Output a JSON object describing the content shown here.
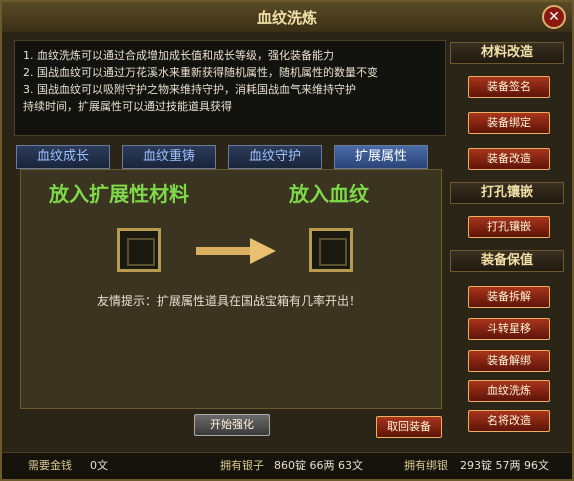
{
  "window": {
    "title": "血纹洗炼",
    "close_label": "✕"
  },
  "description": {
    "lines": [
      "1. 血纹洗炼可以通过合成增加成长值和成长等级，强化装备能力",
      "2. 国战血纹可以通过万花溪水来重新获得随机属性，随机属性的数量不变",
      "3. 国战血纹可以吸附守护之物来维持守护，消耗国战血气来维持守护",
      "持续时间，扩展属性可以通过技能道具获得"
    ]
  },
  "tabs": [
    {
      "label": "血纹成长"
    },
    {
      "label": "血纹重铸"
    },
    {
      "label": "血纹守护"
    },
    {
      "label": "扩展属性"
    }
  ],
  "panel": {
    "left_header": "放入扩展性材料",
    "right_header": "放入血纹",
    "tip": "友情提示：扩展属性道具在国战宝箱有几率开出！"
  },
  "buttons": {
    "start": "开始强化",
    "takeback": "取回装备"
  },
  "side": {
    "section1": "材料改造",
    "section1_items": [
      "装备签名",
      "装备绑定",
      "装备改造"
    ],
    "section2": "打孔镶嵌",
    "section2_items": [
      "打孔镶嵌"
    ],
    "section3": "装备保值",
    "section3_items": [
      "装备拆解",
      "斗转星移",
      "装备解绑",
      "血纹洗炼",
      "名将改造"
    ]
  },
  "footer": {
    "need_money_label": "需要金钱",
    "need_money_value": "0文",
    "silver_label": "拥有银子",
    "silver_value": "860锭 66两 63文",
    "bound_silver_label": "拥有绑银",
    "bound_silver_value": "293锭 57两 96文"
  }
}
